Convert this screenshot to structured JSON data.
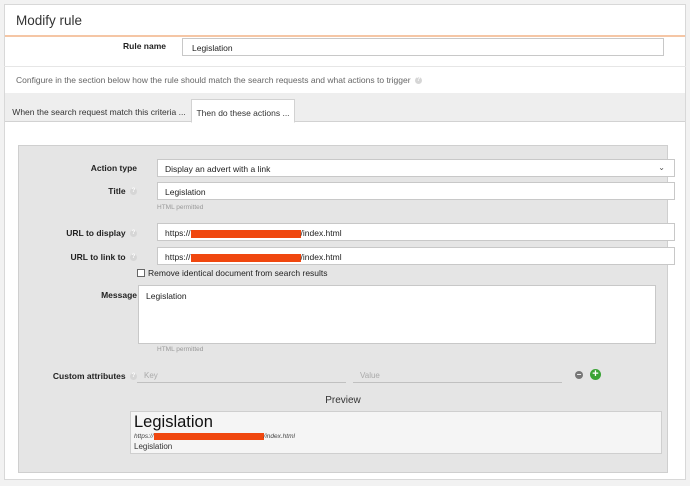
{
  "header": {
    "title": "Modify rule"
  },
  "rule_name": {
    "label": "Rule name",
    "value": "Legislation"
  },
  "configure_text": "Configure in the section below how the rule should match the search requests and what actions to trigger",
  "tabs": [
    {
      "label": "When the search request match this criteria ...",
      "active": false
    },
    {
      "label": "Then do these actions ...",
      "active": true
    }
  ],
  "form": {
    "action_type": {
      "label": "Action type",
      "value": "Display an advert with a link"
    },
    "title": {
      "label": "Title",
      "value": "Legislation",
      "hint": "HTML permitted"
    },
    "url_display": {
      "label": "URL to display",
      "prefix": "https://",
      "suffix": "/index.html"
    },
    "url_link": {
      "label": "URL to link to",
      "prefix": "https://",
      "suffix": "/index.html"
    },
    "remove_identical": {
      "label": "Remove identical document from search results",
      "checked": false
    },
    "message": {
      "label": "Message",
      "value": "Legislation",
      "hint": "HTML permitted"
    },
    "custom_attributes": {
      "label": "Custom attributes",
      "key_placeholder": "Key",
      "value_placeholder": "Value"
    }
  },
  "preview": {
    "heading": "Preview",
    "title": "Legislation",
    "url_prefix": "https://",
    "url_suffix": "/index.html",
    "message": "Legislation"
  },
  "colors": {
    "redaction": "#f0470f",
    "add_button": "#3aa335",
    "header_underline": "#f5c6a5"
  }
}
